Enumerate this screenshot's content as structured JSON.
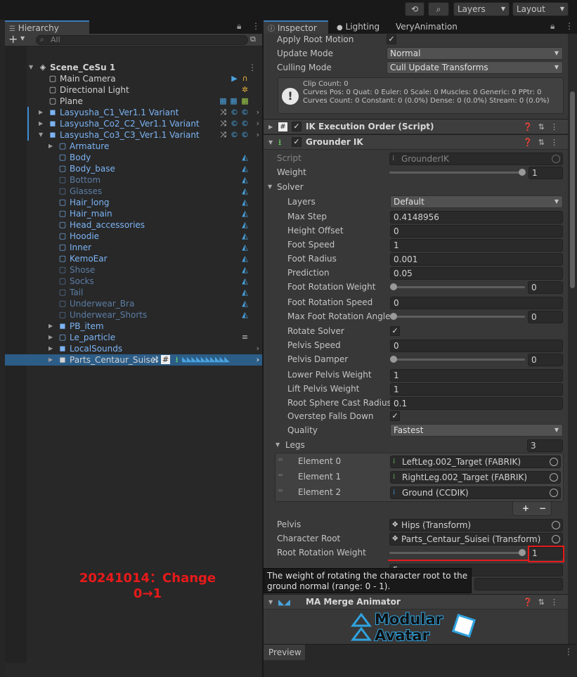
{
  "toolbar": {
    "layers_label": "Layers",
    "layout_label": "Layout"
  },
  "hierarchy": {
    "tab_label": "Hierarchy",
    "add_button": "+",
    "search_placeholder": "All",
    "items": [
      {
        "label": "Scene_CeSu 1"
      },
      {
        "label": "Main Camera"
      },
      {
        "label": "Directional Light"
      },
      {
        "label": "Plane"
      },
      {
        "label": "Lasyusha_C1_Ver1.1 Variant"
      },
      {
        "label": "Lasyusha_Co2_C2_Ver1.1 Variant"
      },
      {
        "label": "Lasyusha_Co3_C3_Ver1.1 Variant"
      },
      {
        "label": "Armature"
      },
      {
        "label": "Body"
      },
      {
        "label": "Body_base"
      },
      {
        "label": "Bottom"
      },
      {
        "label": "Glasses"
      },
      {
        "label": "Hair_long"
      },
      {
        "label": "Hair_main"
      },
      {
        "label": "Head_accessories"
      },
      {
        "label": "Hoodie"
      },
      {
        "label": "Inner"
      },
      {
        "label": "KemoEar"
      },
      {
        "label": "Shose"
      },
      {
        "label": "Socks"
      },
      {
        "label": "Tail"
      },
      {
        "label": "Underwear_Bra"
      },
      {
        "label": "Underwear_Shorts"
      },
      {
        "label": "PB_item"
      },
      {
        "label": "Le_particle"
      },
      {
        "label": "LocalSounds"
      },
      {
        "label": "Parts_Centaur_Suisei"
      }
    ]
  },
  "annotation": {
    "line1": "20241014：Change",
    "line2": "0→1"
  },
  "inspector": {
    "tabs": [
      "Inspector",
      "Lighting",
      "VeryAnimation"
    ],
    "apply_root_motion": "Apply Root Motion",
    "update_mode_label": "Update Mode",
    "update_mode_value": "Normal",
    "culling_mode_label": "Culling Mode",
    "culling_mode_value": "Cull Update Transforms",
    "info_lines": [
      "Clip Count: 0",
      "Curves Pos: 0 Quat: 0 Euler: 0 Scale: 0 Muscles: 0 Generic: 0 PPtr: 0",
      "Curves Count: 0 Constant: 0 (0.0%) Dense: 0 (0.0%) Stream: 0 (0.0%)"
    ],
    "ik_exec_title": "IK Execution Order (Script)",
    "grounder_title": "Grounder IK",
    "script_label": "Script",
    "script_value": "GrounderIK",
    "weight_label": "Weight",
    "weight_value": "1",
    "solver_label": "Solver",
    "layers_label": "Layers",
    "layers_value": "Default",
    "max_step_label": "Max Step",
    "max_step_value": "0.4148956",
    "height_offset_label": "Height Offset",
    "height_offset_value": "0",
    "foot_speed_label": "Foot Speed",
    "foot_speed_value": "1",
    "foot_radius_label": "Foot Radius",
    "foot_radius_value": "0.001",
    "prediction_label": "Prediction",
    "prediction_value": "0.05",
    "foot_rot_weight_label": "Foot Rotation Weight",
    "foot_rot_weight_value": "0",
    "foot_rot_speed_label": "Foot Rotation Speed",
    "foot_rot_speed_value": "0",
    "max_foot_rot_label": "Max Foot Rotation Angle",
    "max_foot_rot_value": "0",
    "rotate_solver_label": "Rotate Solver",
    "pelvis_speed_label": "Pelvis Speed",
    "pelvis_speed_value": "0",
    "pelvis_damper_label": "Pelvis Damper",
    "pelvis_damper_value": "0",
    "lower_pelvis_label": "Lower Pelvis Weight",
    "lower_pelvis_value": "1",
    "lift_pelvis_label": "Lift Pelvis Weight",
    "lift_pelvis_value": "1",
    "root_sphere_label": "Root Sphere Cast Radius",
    "root_sphere_value": "0.1",
    "overstep_label": "Overstep Falls Down",
    "quality_label": "Quality",
    "quality_value": "Fastest",
    "legs_label": "Legs",
    "legs_count": "3",
    "legs": [
      {
        "label": "Element 0",
        "value": "LeftLeg.002_Target (FABRIK)"
      },
      {
        "label": "Element 1",
        "value": "RightLeg.002_Target (FABRIK)"
      },
      {
        "label": "Element 2",
        "value": "Ground (CCDIK)"
      }
    ],
    "pelvis_label": "Pelvis",
    "pelvis_value": "Hips (Transform)",
    "char_root_label": "Character Root",
    "char_root_value": "Parts_Centaur_Suisei (Transform)",
    "root_rot_weight_label": "Root Rotation Weight",
    "root_rot_weight_value": "1",
    "root_rot_speed_value": "5",
    "tooltip_line1": "The weight of rotating the character root to the",
    "tooltip_line2": "ground normal (range: 0 - 1).",
    "ma_title": "MA Merge Animator",
    "logo_line1": "Modular",
    "logo_line2": "Avatar",
    "preview_label": "Preview"
  },
  "sliders": {
    "weight": 1,
    "foot_rotation_weight": 0,
    "max_foot_rotation_angle": 0,
    "pelvis_damper": 0,
    "root_rotation_weight": 1
  },
  "colors": {
    "accent_blue": "#3a79bb",
    "selection": "#2c5d87",
    "annotation_red": "#e81a1a"
  }
}
